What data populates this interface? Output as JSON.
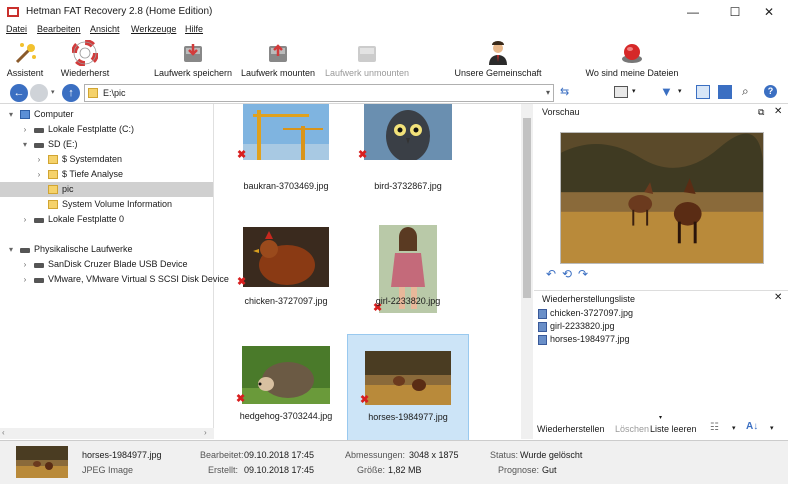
{
  "window": {
    "title": "Hetman FAT Recovery 2.8 (Home Edition)",
    "minimize": "—",
    "maximize": "☐",
    "close": "✕"
  },
  "menu": [
    "Datei",
    "Bearbeiten",
    "Ansicht",
    "Werkzeuge",
    "Hilfe"
  ],
  "toolbar": {
    "assistent": "Assistent",
    "wiederherst": "Wiederherst",
    "laufwerk_speichern": "Laufwerk speichern",
    "laufwerk_mounten": "Laufwerk mounten",
    "laufwerk_unmounten": "Laufwerk unmounten",
    "unsere_gemeinschaft": "Unsere Gemeinschaft",
    "wo_sind": "Wo sind meine Dateien"
  },
  "address": {
    "path": "E:\\pic"
  },
  "tree": [
    {
      "label": "Computer",
      "level": 0,
      "expander": "▾",
      "icon": "computer"
    },
    {
      "label": "Lokale Festplatte (C:)",
      "level": 1,
      "expander": "›",
      "icon": "drive"
    },
    {
      "label": "SD (E:)",
      "level": 1,
      "expander": "▾",
      "icon": "drive"
    },
    {
      "label": "$ Systemdaten",
      "level": 2,
      "expander": "›",
      "icon": "folder"
    },
    {
      "label": "$ Tiefe Analyse",
      "level": 2,
      "expander": "›",
      "icon": "folder"
    },
    {
      "label": "pic",
      "level": 2,
      "expander": "",
      "icon": "folder-deleted",
      "selected": true
    },
    {
      "label": "System Volume Information",
      "level": 2,
      "expander": "",
      "icon": "folder"
    },
    {
      "label": "Lokale Festplatte 0",
      "level": 1,
      "expander": "›",
      "icon": "drive"
    },
    {
      "label": "",
      "level": 0,
      "expander": "",
      "icon": ""
    },
    {
      "label": "Physikalische Laufwerke",
      "level": 0,
      "expander": "▾",
      "icon": "drive"
    },
    {
      "label": "SanDisk Cruzer Blade USB Device",
      "level": 1,
      "expander": "›",
      "icon": "drive"
    },
    {
      "label": "VMware, VMware Virtual S SCSI Disk Device",
      "level": 1,
      "expander": "›",
      "icon": "drive"
    }
  ],
  "files": [
    {
      "name": "baukran-3703469.jpg"
    },
    {
      "name": "bird-3732867.jpg"
    },
    {
      "name": "chicken-3727097.jpg"
    },
    {
      "name": "girl-2233820.jpg"
    },
    {
      "name": "hedgehog-3703244.jpg"
    },
    {
      "name": "horses-1984977.jpg",
      "selected": true
    }
  ],
  "preview": {
    "header": "Vorschau"
  },
  "recovery_list": {
    "header": "Wiederherstellungsliste",
    "items": [
      "chicken-3727097.jpg",
      "girl-2233820.jpg",
      "horses-1984977.jpg"
    ],
    "wiederherstellen": "Wiederherstellen",
    "loeschen": "Löschen",
    "liste_leeren": "Liste leeren"
  },
  "status": {
    "filename": "horses-1984977.jpg",
    "filetype": "JPEG Image",
    "bearbeitet_label": "Bearbeitet:",
    "bearbeitet": "09.10.2018 17:45",
    "erstellt_label": "Erstellt:",
    "erstellt": "09.10.2018 17:45",
    "abmessungen_label": "Abmessungen:",
    "abmessungen": "3048 x 1875",
    "groesse_label": "Größe:",
    "groesse": "1,82 MB",
    "status_label": "Status:",
    "status": "Wurde gelöscht",
    "prognose_label": "Prognose:",
    "prognose": "Gut"
  }
}
